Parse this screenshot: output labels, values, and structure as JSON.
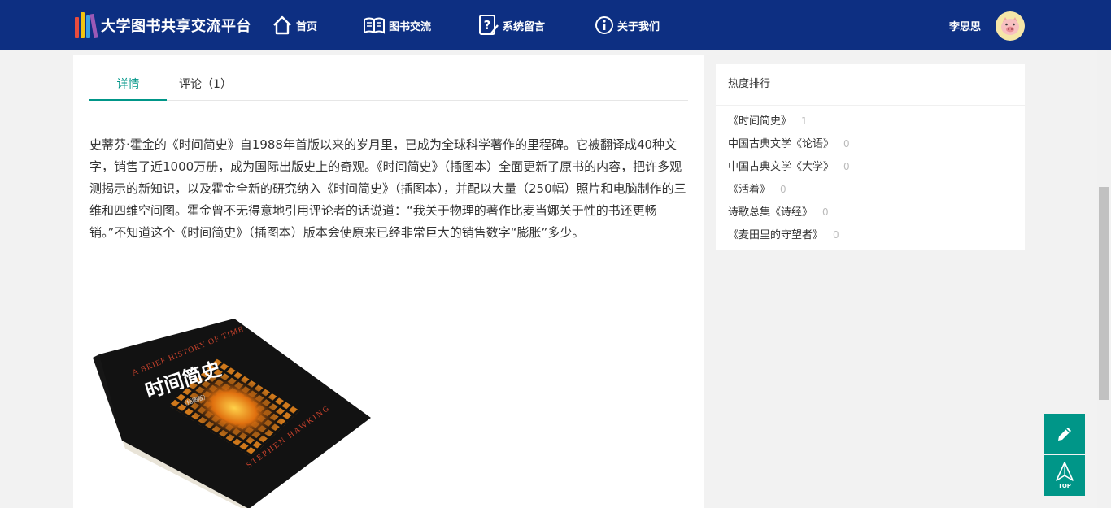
{
  "header": {
    "brand_title": "大学图书共享交流平台",
    "nav": [
      {
        "label": "首页",
        "icon": "home-icon"
      },
      {
        "label": "图书交流",
        "icon": "book-open-icon"
      },
      {
        "label": "系统留言",
        "icon": "help-edit-icon"
      },
      {
        "label": "关于我们",
        "icon": "info-icon"
      }
    ],
    "user_name": "李思思",
    "avatar_icon": "pig-avatar-icon"
  },
  "tabs": [
    {
      "label": "详情",
      "active": true
    },
    {
      "label": "评论（1）",
      "active": false
    }
  ],
  "description": "史蒂芬·霍金的《时间简史》自1988年首版以来的岁月里，已成为全球科学著作的里程碑。它被翻译成40种文字，销售了近1000万册，成为国际出版史上的奇观。《时间简史》（插图本）全面更新了原书的内容，把许多观测揭示的新知识，以及霍金全新的研究纳入《时间简史》（插图本），并配以大量（250幅）照片和电脑制作的三维和四维空间图。霍金曾不无得意地引用评论者的话说道：“我关于物理的著作比麦当娜关于性的书还更畅销。”不知道这个《时间简史》（插图本）版本会使原来已经非常巨大的销售数字“膨胀”多少。",
  "book_cover": {
    "title_cn": "时间简史",
    "title_en": "A BRIEF HISTORY OF TIME",
    "edition": "（插图版）",
    "author": "STEPHEN HAWKING"
  },
  "sidebar": {
    "title": "热度排行",
    "items": [
      {
        "label": "《时间简史》",
        "count": "1"
      },
      {
        "label": "中国古典文学《论语》",
        "count": "0"
      },
      {
        "label": "中国古典文学《大学》",
        "count": "0"
      },
      {
        "label": "《活着》",
        "count": "0"
      },
      {
        "label": "诗歌总集《诗经》",
        "count": "0"
      },
      {
        "label": "《麦田里的守望者》",
        "count": "0"
      }
    ]
  },
  "fab": {
    "edit_icon": "pencil-icon",
    "top_label": "TOP"
  },
  "colors": {
    "header_bg": "#0d2f82",
    "accent": "#009688",
    "page_bg": "#f2f2f2"
  }
}
